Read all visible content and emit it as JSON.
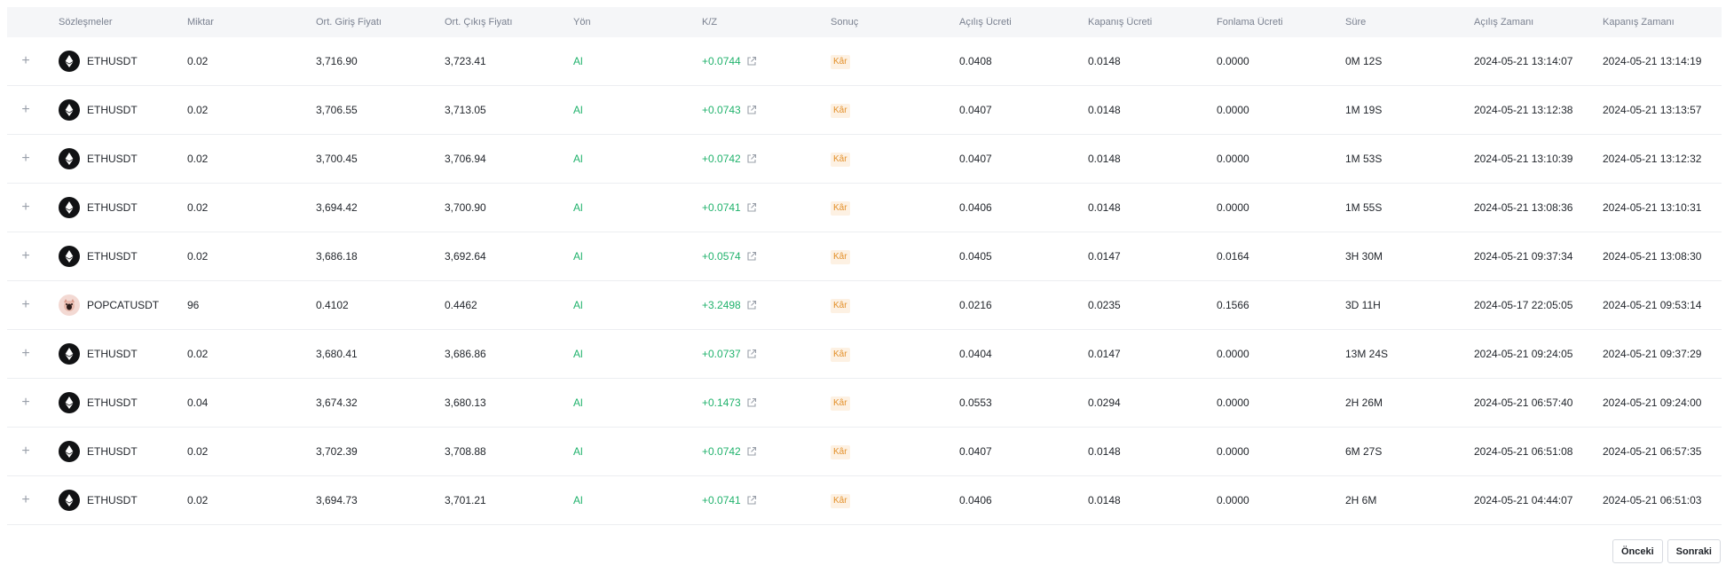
{
  "columns": {
    "contracts": "Sözleşmeler",
    "quantity": "Miktar",
    "avg_entry": "Ort. Giriş Fiyatı",
    "avg_exit": "Ort. Çıkış Fiyatı",
    "direction": "Yön",
    "pnl": "K/Z",
    "result": "Sonuç",
    "open_fee": "Açılış Ücreti",
    "close_fee": "Kapanış Ücreti",
    "funding_fee": "Fonlama Ücreti",
    "duration": "Süre",
    "open_time": "Açılış Zamanı",
    "close_time": "Kapanış Zamanı"
  },
  "colors": {
    "profit": "#20b26c",
    "badge_bg": "#fdf1e3",
    "badge_text": "#e3902a",
    "header_bg": "#f5f6f8"
  },
  "rows": [
    {
      "pair": "ETHUSDT",
      "coin_icon": "eth-icon",
      "qty": "0.02",
      "entry": "3,716.90",
      "exit": "3,723.41",
      "dir": "Al",
      "pnl": "+0.0744",
      "result": "Kâr",
      "open_fee": "0.0408",
      "close_fee": "0.0148",
      "funding": "0.0000",
      "duration": "0M 12S",
      "open_time": "2024-05-21 13:14:07",
      "close_time": "2024-05-21 13:14:19"
    },
    {
      "pair": "ETHUSDT",
      "coin_icon": "eth-icon",
      "qty": "0.02",
      "entry": "3,706.55",
      "exit": "3,713.05",
      "dir": "Al",
      "pnl": "+0.0743",
      "result": "Kâr",
      "open_fee": "0.0407",
      "close_fee": "0.0148",
      "funding": "0.0000",
      "duration": "1M 19S",
      "open_time": "2024-05-21 13:12:38",
      "close_time": "2024-05-21 13:13:57"
    },
    {
      "pair": "ETHUSDT",
      "coin_icon": "eth-icon",
      "qty": "0.02",
      "entry": "3,700.45",
      "exit": "3,706.94",
      "dir": "Al",
      "pnl": "+0.0742",
      "result": "Kâr",
      "open_fee": "0.0407",
      "close_fee": "0.0148",
      "funding": "0.0000",
      "duration": "1M 53S",
      "open_time": "2024-05-21 13:10:39",
      "close_time": "2024-05-21 13:12:32"
    },
    {
      "pair": "ETHUSDT",
      "coin_icon": "eth-icon",
      "qty": "0.02",
      "entry": "3,694.42",
      "exit": "3,700.90",
      "dir": "Al",
      "pnl": "+0.0741",
      "result": "Kâr",
      "open_fee": "0.0406",
      "close_fee": "0.0148",
      "funding": "0.0000",
      "duration": "1M 55S",
      "open_time": "2024-05-21 13:08:36",
      "close_time": "2024-05-21 13:10:31"
    },
    {
      "pair": "ETHUSDT",
      "coin_icon": "eth-icon",
      "qty": "0.02",
      "entry": "3,686.18",
      "exit": "3,692.64",
      "dir": "Al",
      "pnl": "+0.0574",
      "result": "Kâr",
      "open_fee": "0.0405",
      "close_fee": "0.0147",
      "funding": "0.0164",
      "duration": "3H 30M",
      "open_time": "2024-05-21 09:37:34",
      "close_time": "2024-05-21 13:08:30"
    },
    {
      "pair": "POPCATUSDT",
      "coin_icon": "popcat-icon",
      "qty": "96",
      "entry": "0.4102",
      "exit": "0.4462",
      "dir": "Al",
      "pnl": "+3.2498",
      "result": "Kâr",
      "open_fee": "0.0216",
      "close_fee": "0.0235",
      "funding": "0.1566",
      "duration": "3D 11H",
      "open_time": "2024-05-17 22:05:05",
      "close_time": "2024-05-21 09:53:14"
    },
    {
      "pair": "ETHUSDT",
      "coin_icon": "eth-icon",
      "qty": "0.02",
      "entry": "3,680.41",
      "exit": "3,686.86",
      "dir": "Al",
      "pnl": "+0.0737",
      "result": "Kâr",
      "open_fee": "0.0404",
      "close_fee": "0.0147",
      "funding": "0.0000",
      "duration": "13M 24S",
      "open_time": "2024-05-21 09:24:05",
      "close_time": "2024-05-21 09:37:29"
    },
    {
      "pair": "ETHUSDT",
      "coin_icon": "eth-icon",
      "qty": "0.04",
      "entry": "3,674.32",
      "exit": "3,680.13",
      "dir": "Al",
      "pnl": "+0.1473",
      "result": "Kâr",
      "open_fee": "0.0553",
      "close_fee": "0.0294",
      "funding": "0.0000",
      "duration": "2H 26M",
      "open_time": "2024-05-21 06:57:40",
      "close_time": "2024-05-21 09:24:00"
    },
    {
      "pair": "ETHUSDT",
      "coin_icon": "eth-icon",
      "qty": "0.02",
      "entry": "3,702.39",
      "exit": "3,708.88",
      "dir": "Al",
      "pnl": "+0.0742",
      "result": "Kâr",
      "open_fee": "0.0407",
      "close_fee": "0.0148",
      "funding": "0.0000",
      "duration": "6M 27S",
      "open_time": "2024-05-21 06:51:08",
      "close_time": "2024-05-21 06:57:35"
    },
    {
      "pair": "ETHUSDT",
      "coin_icon": "eth-icon",
      "qty": "0.02",
      "entry": "3,694.73",
      "exit": "3,701.21",
      "dir": "Al",
      "pnl": "+0.0741",
      "result": "Kâr",
      "open_fee": "0.0406",
      "close_fee": "0.0148",
      "funding": "0.0000",
      "duration": "2H 6M",
      "open_time": "2024-05-21 04:44:07",
      "close_time": "2024-05-21 06:51:03"
    }
  ],
  "pagination": {
    "prev_label": "Önceki",
    "next_label": "Sonraki"
  }
}
